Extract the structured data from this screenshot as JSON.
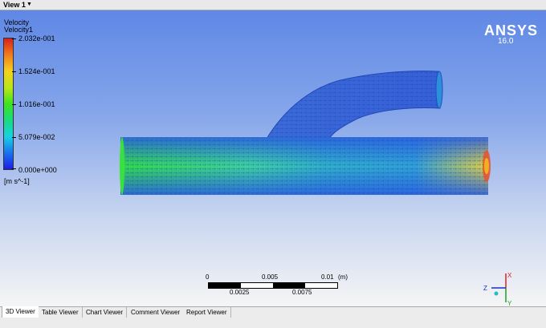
{
  "view": {
    "title": "View 1",
    "caret": "▼"
  },
  "legend": {
    "title": "Velocity",
    "variable": "Velocity1",
    "ticks": [
      "2.032e-001",
      "1.524e-001",
      "1.016e-001",
      "5.079e-002",
      "0.000e+000"
    ],
    "unit": "[m s^-1]"
  },
  "brand": {
    "name": "ANSYS",
    "version": "16.0"
  },
  "scale": {
    "top_labels": [
      "0",
      "0.005",
      "0.01",
      "(m)"
    ],
    "bottom_labels": [
      "0.0025",
      "0.0075"
    ]
  },
  "axis": {
    "x": "X",
    "y": "Y",
    "z": "Z"
  },
  "tabs": [
    {
      "label": "3D Viewer",
      "active": true
    },
    {
      "label": "Table Viewer",
      "active": false
    },
    {
      "label": "Chart Viewer",
      "active": false
    },
    {
      "label": "Comment Viewer",
      "active": false
    },
    {
      "label": "Report Viewer",
      "active": false
    }
  ],
  "colors": {
    "x_axis": "#e02020",
    "y_axis": "#20a020",
    "z_axis": "#1030d0"
  }
}
